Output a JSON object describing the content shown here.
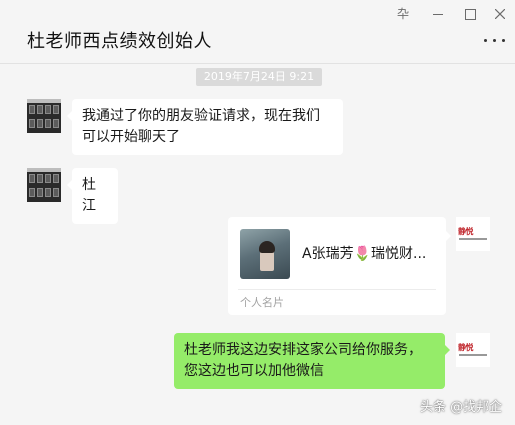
{
  "window": {
    "pin_glyph": "卆",
    "title": "杜老师西点绩效创始人"
  },
  "chat": {
    "timestamp": "2019年7月24日 9:21",
    "messages": [
      {
        "side": "left",
        "text": "我通过了你的朋友验证请求，现在我们可以开始聊天了"
      },
      {
        "side": "left",
        "text": "杜江"
      },
      {
        "side": "right",
        "type": "contact_card",
        "name": "A张瑞芳🌷瑞悦财...",
        "label": "个人名片"
      },
      {
        "side": "right",
        "text": "杜老师我这边安排这家公司给你服务，您这边也可以加他微信"
      }
    ],
    "right_avatar_brand": "静悦"
  },
  "watermark": "头条 @找邦企",
  "colors": {
    "background": "#f5f5f5",
    "sent_bubble": "#95ec69",
    "received_bubble": "#ffffff"
  }
}
